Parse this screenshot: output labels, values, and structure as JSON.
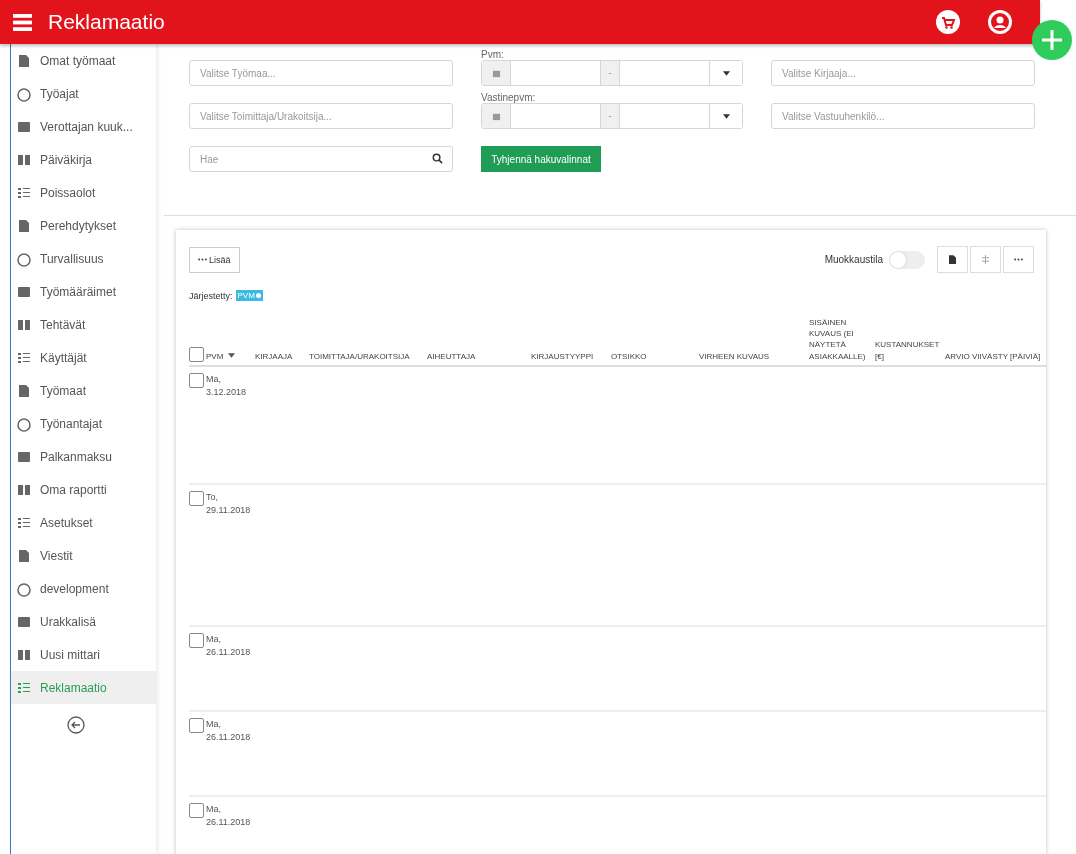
{
  "header": {
    "title": "Reklamaatio"
  },
  "sidebar": {
    "items": [
      {
        "label": "Omat työmaat",
        "selected": false
      },
      {
        "label": "Työajat",
        "selected": false
      },
      {
        "label": "Verottajan kuuk...",
        "selected": false
      },
      {
        "label": "Päiväkirja",
        "selected": false
      },
      {
        "label": "Poissaolot",
        "selected": false
      },
      {
        "label": "Perehdytykset",
        "selected": false
      },
      {
        "label": "Turvallisuus",
        "selected": false
      },
      {
        "label": "Työmääräimet",
        "selected": false
      },
      {
        "label": "Tehtävät",
        "selected": false
      },
      {
        "label": "Käyttäjät",
        "selected": false
      },
      {
        "label": "Työmaat",
        "selected": false
      },
      {
        "label": "Työnantajat",
        "selected": false
      },
      {
        "label": "Palkanmaksu",
        "selected": false
      },
      {
        "label": "Oma raportti",
        "selected": false
      },
      {
        "label": "Asetukset",
        "selected": false
      },
      {
        "label": "Viestit",
        "selected": false
      },
      {
        "label": "development",
        "selected": false
      },
      {
        "label": "Urakkalisä",
        "selected": false
      },
      {
        "label": "Uusi mittari",
        "selected": false
      },
      {
        "label": "Reklamaatio",
        "selected": true
      }
    ]
  },
  "filters": {
    "worksite": {
      "placeholder": "Valitse Työmaa..."
    },
    "supplier": {
      "placeholder": "Valitse Toimittaja/Urakoitsija..."
    },
    "search": {
      "placeholder": "Hae"
    },
    "date_label": "Pvm:",
    "date_separator": "-",
    "response_date_label": "Vastinepvm:",
    "response_date_separator": "-",
    "clear_button": "Tyhjennä hakuvalinnat",
    "recorder": {
      "placeholder": "Valitse Kirjaaja..."
    },
    "responsible": {
      "placeholder": "Valitse Vastuuhenkilö..."
    }
  },
  "table_toolbar": {
    "add_button": "Lisää",
    "edit_mode_label": "Muokkaustila",
    "edit_mode_on": false,
    "sorted_label": "Järjestetty:",
    "sort_tag": "PVM"
  },
  "table": {
    "columns": [
      "PVM",
      "KIRJAAJA",
      "TOIMITTAJA/URAKOITSIJA",
      "AIHEUTTAJA",
      "KIRJAUSTYYPPI",
      "OTSIKKO",
      "VIRHEEN KUVAUS",
      "SISÄINEN KUVAUS (EI NÄYTETÄ ASIAKKAALLE)",
      "KUSTANNUKSET [€]",
      "ARVIO VIIVÄSTY [PÄIVIÄ]"
    ],
    "select_all_checked": false,
    "rows": [
      {
        "day": "Ma,",
        "date": "3.12.2018",
        "checked": false
      },
      {
        "day": "To,",
        "date": "29.11.2018",
        "checked": false
      },
      {
        "day": "Ma,",
        "date": "26.11.2018",
        "checked": false
      },
      {
        "day": "Ma,",
        "date": "26.11.2018",
        "checked": false
      },
      {
        "day": "Ma,",
        "date": "26.11.2018",
        "checked": false
      }
    ]
  }
}
